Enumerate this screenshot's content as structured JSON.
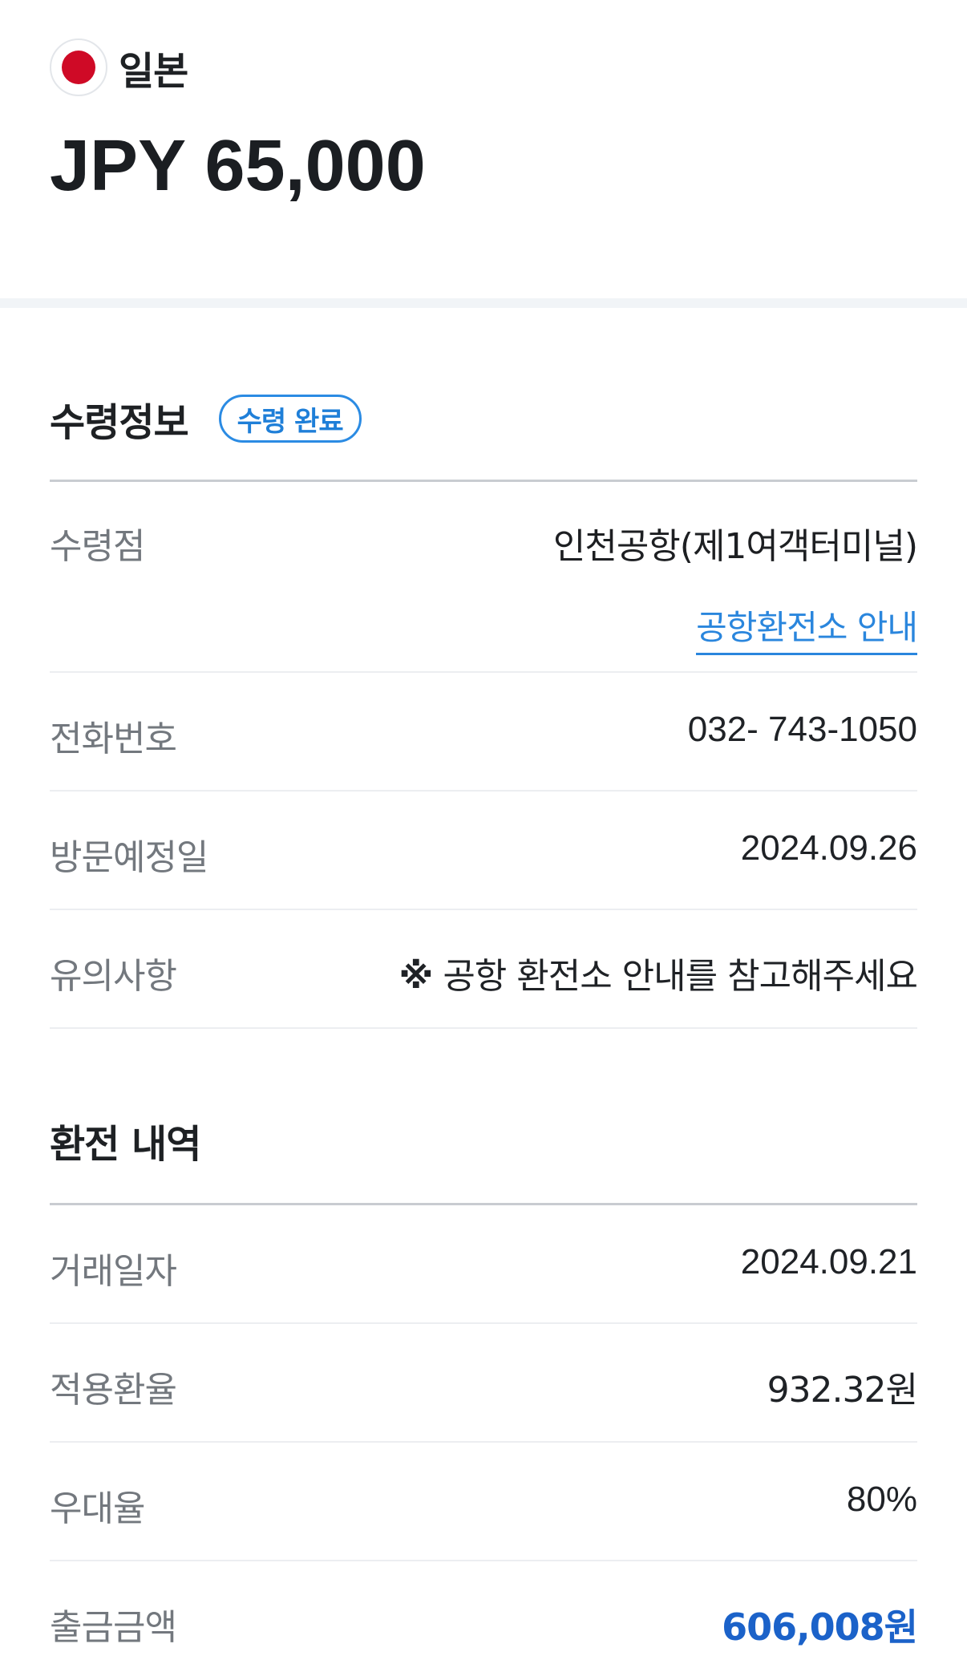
{
  "header": {
    "country": "일본",
    "amount": "JPY 65,000"
  },
  "receipt": {
    "title": "수령정보",
    "badge": "수령 완료",
    "rows": [
      {
        "label": "수령점",
        "value": "인천공항(제1여객터미널)",
        "link": "공항환전소 안내"
      },
      {
        "label": "전화번호",
        "value": "032- 743-1050"
      },
      {
        "label": "방문예정일",
        "value": "2024.09.26"
      },
      {
        "label": "유의사항",
        "mark": "※",
        "value": "공항 환전소 안내를 참고해주세요"
      }
    ]
  },
  "exchange": {
    "title": "환전 내역",
    "rows": [
      {
        "label": "거래일자",
        "value": "2024.09.21"
      },
      {
        "label": "적용환율",
        "value": "932.32원"
      },
      {
        "label": "우대율",
        "value": "80%"
      },
      {
        "label": "출금금액",
        "value": "606,008원"
      }
    ]
  },
  "colors": {
    "accent": "#2b8be3",
    "amount_blue": "#1b62c9",
    "flag_red": "#cf0a26"
  }
}
